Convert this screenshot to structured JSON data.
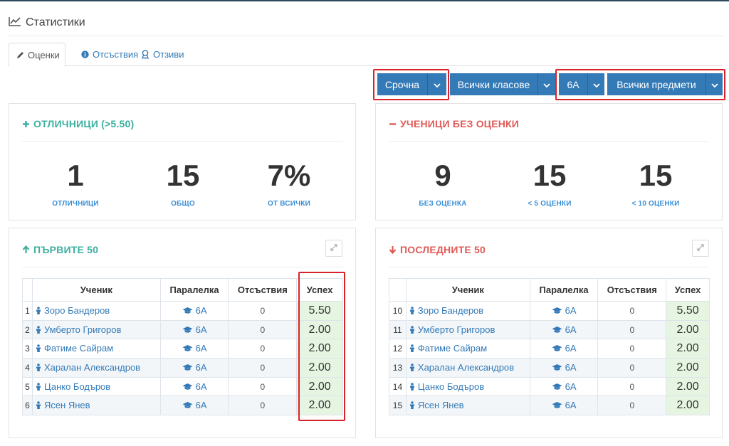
{
  "page": {
    "title": "Статистики",
    "title_icon": "line-chart-icon"
  },
  "tabs": [
    {
      "label": "Оценки",
      "icon": "pencil-icon",
      "active": true
    },
    {
      "label": "Отсъствия",
      "icon": "info-circle-icon",
      "active": false
    },
    {
      "label": "Отзиви",
      "icon": "award-icon",
      "active": false
    }
  ],
  "filters": {
    "type": "Срочна",
    "classes": "Всички класове",
    "class": "6А",
    "subjects": "Всички предмети"
  },
  "colors": {
    "primary": "#337ab7",
    "green": "#3cb0a0",
    "red": "#e05a56",
    "highlight": "#d9232a",
    "grade_bg": "#e6f5e1"
  },
  "excellent": {
    "title": "ОТЛИЧНИЦИ (>5.50)",
    "stats": [
      {
        "value": "1",
        "label": "ОТЛИЧНИЦИ"
      },
      {
        "value": "15",
        "label": "ОБЩО"
      },
      {
        "value": "7%",
        "label": "ОТ ВСИЧКИ"
      }
    ]
  },
  "nograde": {
    "title": "УЧЕНИЦИ БЕЗ ОЦЕНКИ",
    "stats": [
      {
        "value": "9",
        "label": "БЕЗ ОЦЕНКА"
      },
      {
        "value": "15",
        "label": "< 5 ОЦЕНКИ"
      },
      {
        "value": "15",
        "label": "< 10 ОЦЕНКИ"
      }
    ]
  },
  "columns": {
    "student": "Ученик",
    "class": "Паралелка",
    "absences": "Отсъствия",
    "success": "Успех"
  },
  "top": {
    "title": "ПЪРВИТЕ 50",
    "rows": [
      {
        "n": "1",
        "name": "Зоро Бандеров",
        "class": "6А",
        "absences": "0",
        "grade": "5.50"
      },
      {
        "n": "2",
        "name": "Умберто Григоров",
        "class": "6А",
        "absences": "0",
        "grade": "2.00"
      },
      {
        "n": "3",
        "name": "Фатиме Сайрам",
        "class": "6А",
        "absences": "0",
        "grade": "2.00"
      },
      {
        "n": "4",
        "name": "Харалан Александров",
        "class": "6А",
        "absences": "0",
        "grade": "2.00"
      },
      {
        "n": "5",
        "name": "Цанко Бодъров",
        "class": "6А",
        "absences": "0",
        "grade": "2.00"
      },
      {
        "n": "6",
        "name": "Ясен Янев",
        "class": "6А",
        "absences": "0",
        "grade": "2.00"
      }
    ]
  },
  "bottom": {
    "title": "ПОСЛЕДНИТЕ 50",
    "rows": [
      {
        "n": "10",
        "name": "Зоро Бандеров",
        "class": "6А",
        "absences": "0",
        "grade": "5.50"
      },
      {
        "n": "11",
        "name": "Умберто Григоров",
        "class": "6А",
        "absences": "0",
        "grade": "2.00"
      },
      {
        "n": "12",
        "name": "Фатиме Сайрам",
        "class": "6А",
        "absences": "0",
        "grade": "2.00"
      },
      {
        "n": "13",
        "name": "Харалан Александров",
        "class": "6А",
        "absences": "0",
        "grade": "2.00"
      },
      {
        "n": "14",
        "name": "Цанко Бодъров",
        "class": "6А",
        "absences": "0",
        "grade": "2.00"
      },
      {
        "n": "15",
        "name": "Ясен Янев",
        "class": "6А",
        "absences": "0",
        "grade": "2.00"
      }
    ]
  }
}
